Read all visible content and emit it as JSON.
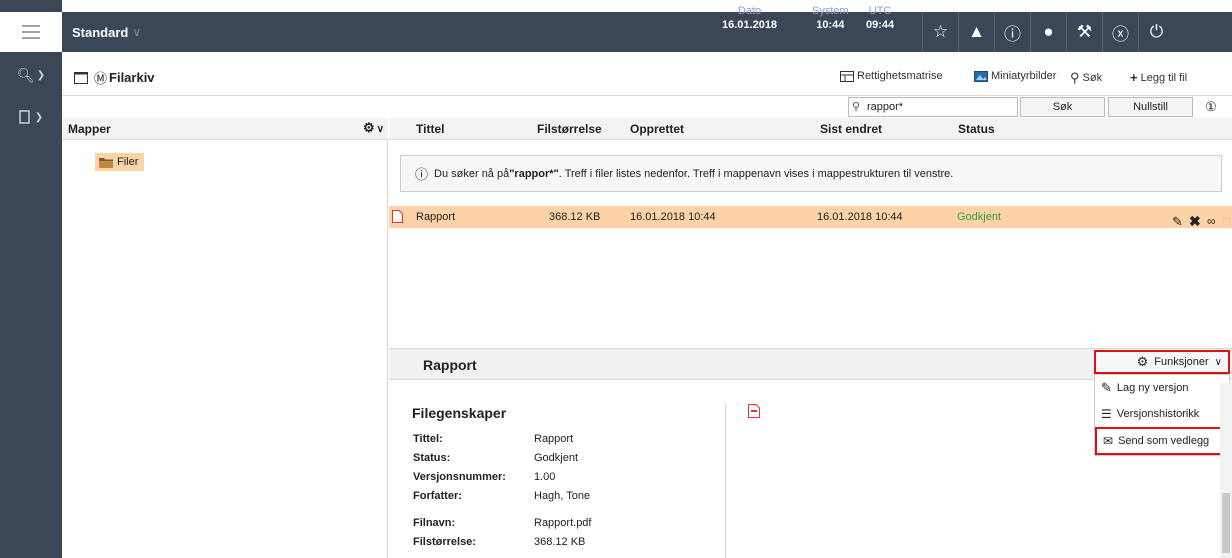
{
  "topbar": {
    "workspace": "Standard",
    "date_label": "Dato",
    "date_value": "16.01.2018",
    "system_label": "System",
    "system_time": "10:44",
    "utc_label": "UTC",
    "utc_time": "09:44"
  },
  "title": "Filarkiv",
  "toolbar": {
    "rights": "Rettighetsmatrise",
    "thumbnails": "Miniatyrbilder",
    "search": "Søk",
    "add_file": "Legg til fil"
  },
  "search": {
    "value": "rappor*",
    "search_btn": "Søk",
    "reset_btn": "Nullstill"
  },
  "folders": {
    "header": "Mapper",
    "items": [
      {
        "label": "Filer"
      }
    ]
  },
  "columns": {
    "title": "Tittel",
    "size": "Filstørrelse",
    "created": "Opprettet",
    "modified": "Sist endret",
    "status": "Status"
  },
  "notice": {
    "prefix": "Du søker nå på ",
    "term": "\"rappor*\"",
    "suffix": ". Treff i filer listes nedenfor. Treff i mappenavn vises i mappestrukturen til venstre."
  },
  "row": {
    "title": "Rapport",
    "size": "368.12 KB",
    "created": "16.01.2018 10:44",
    "modified": "16.01.2018 10:44",
    "status": "Godkjent"
  },
  "detail": {
    "title": "Rapport",
    "props_title": "Filegenskaper",
    "props": [
      {
        "label": "Tittel:",
        "value": "Rapport"
      },
      {
        "label": "Status:",
        "value": "Godkjent"
      },
      {
        "label": "Versjonsnummer:",
        "value": "1.00"
      },
      {
        "label": "Forfatter:",
        "value": "Hagh, Tone"
      },
      {
        "label": "Filnavn:",
        "value": "Rapport.pdf"
      },
      {
        "label": "Filstørrelse:",
        "value": "368.12 KB"
      }
    ]
  },
  "functions": {
    "button": "Funksjoner",
    "items": [
      {
        "label": "Lag ny versjon"
      },
      {
        "label": "Versjonshistorikk"
      },
      {
        "label": "Send som vedlegg"
      }
    ]
  },
  "colors": {
    "dark_bar": "#3b4656",
    "row_highlight": "#fbd3a6",
    "status_green": "#3c9a3c",
    "highlight_red": "#dd1111"
  }
}
